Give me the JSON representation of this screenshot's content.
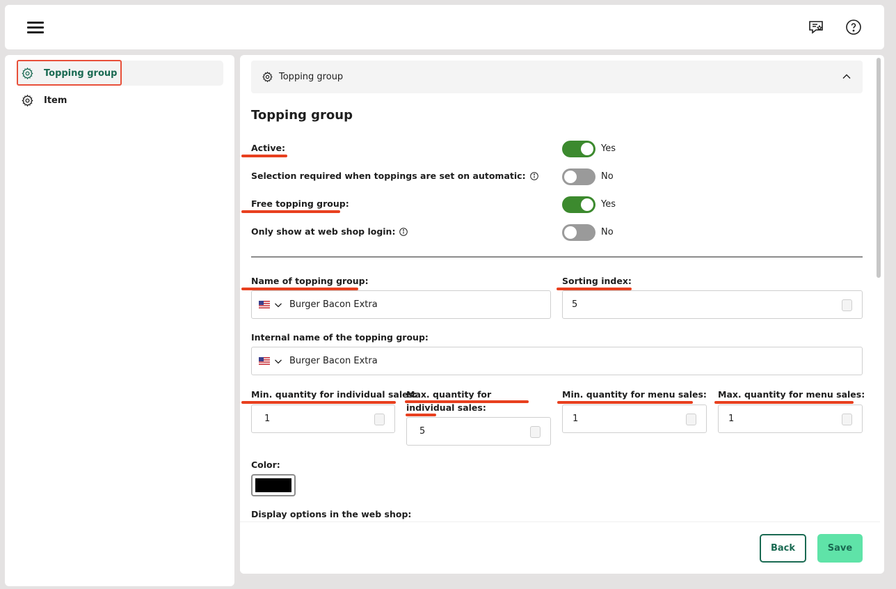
{
  "sidebar": {
    "items": [
      {
        "label": "Topping group",
        "icon": "gear-icon"
      },
      {
        "label": "Item",
        "icon": "gear-icon"
      }
    ]
  },
  "section": {
    "header": "Topping group",
    "title": "Topping group"
  },
  "toggles": [
    {
      "label": "Active:",
      "value": "Yes"
    },
    {
      "label": "Selection required when toppings are set on automatic:",
      "value": "No"
    },
    {
      "label": "Free topping group:",
      "value": "Yes"
    },
    {
      "label": "Only show at web shop login:",
      "value": "No"
    }
  ],
  "fields": {
    "name_label": "Name of topping group:",
    "name_value": "Burger Bacon Extra",
    "sorting_label": "Sorting index:",
    "sorting_value": "5",
    "internal_label": "Internal name of the topping group:",
    "internal_value": "Burger Bacon Extra",
    "min_individual_label": "Min. quantity for individual sales:",
    "min_individual_value": "1",
    "max_individual_label": "Max. quantity for individual sales:",
    "max_individual_value": "5",
    "min_menu_label": "Min. quantity for menu sales:",
    "min_menu_value": "1",
    "max_menu_label": "Max. quantity for menu sales:",
    "max_menu_value": "1",
    "color_label": "Color:",
    "color_value": "#000000",
    "display_label": "Display options in the web shop:"
  },
  "buttons": {
    "back": "Back",
    "save": "Save"
  },
  "colors": {
    "accent": "#1a6a52",
    "toggle_on": "#3c8a2e",
    "save_bg": "#5fe3a8",
    "annotation": "#e8401f"
  }
}
